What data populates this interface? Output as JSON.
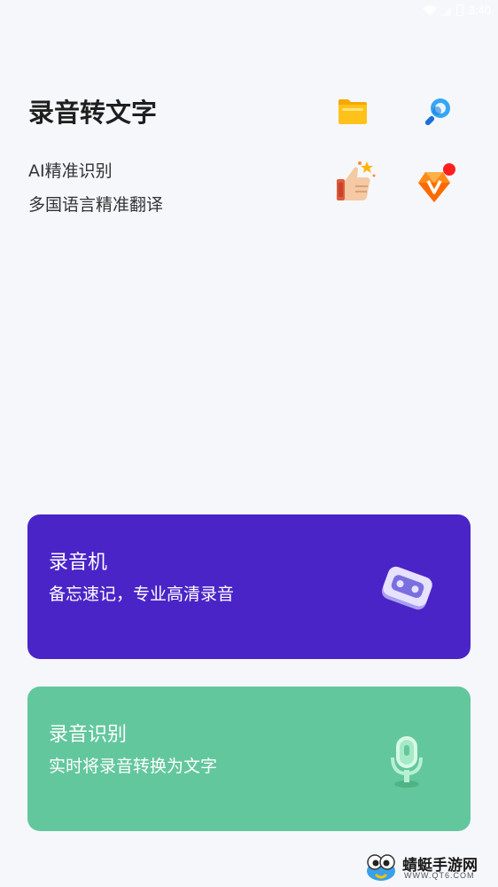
{
  "status_bar": {
    "time": "3:40"
  },
  "header": {
    "title": "录音转文字",
    "subtitle_1": "AI精准识别",
    "subtitle_2": "多国语言精准翻译",
    "icons": [
      "folder-icon",
      "search-icon",
      "thumbs-up-icon",
      "vip-diamond-icon"
    ]
  },
  "cards": [
    {
      "title": "录音机",
      "desc": "备忘速记，专业高清录音",
      "color": "#4b24c8",
      "icon": "cassette-icon"
    },
    {
      "title": "录音识别",
      "desc": "实时将录音转换为文字",
      "color": "#63c79d",
      "icon": "microphone-icon"
    }
  ],
  "watermark": {
    "name": "蜻蜓手游网",
    "url": "WWW.QT6.COM"
  },
  "colors": {
    "background": "#f6f7fb",
    "badge": "#ff1f1f"
  }
}
